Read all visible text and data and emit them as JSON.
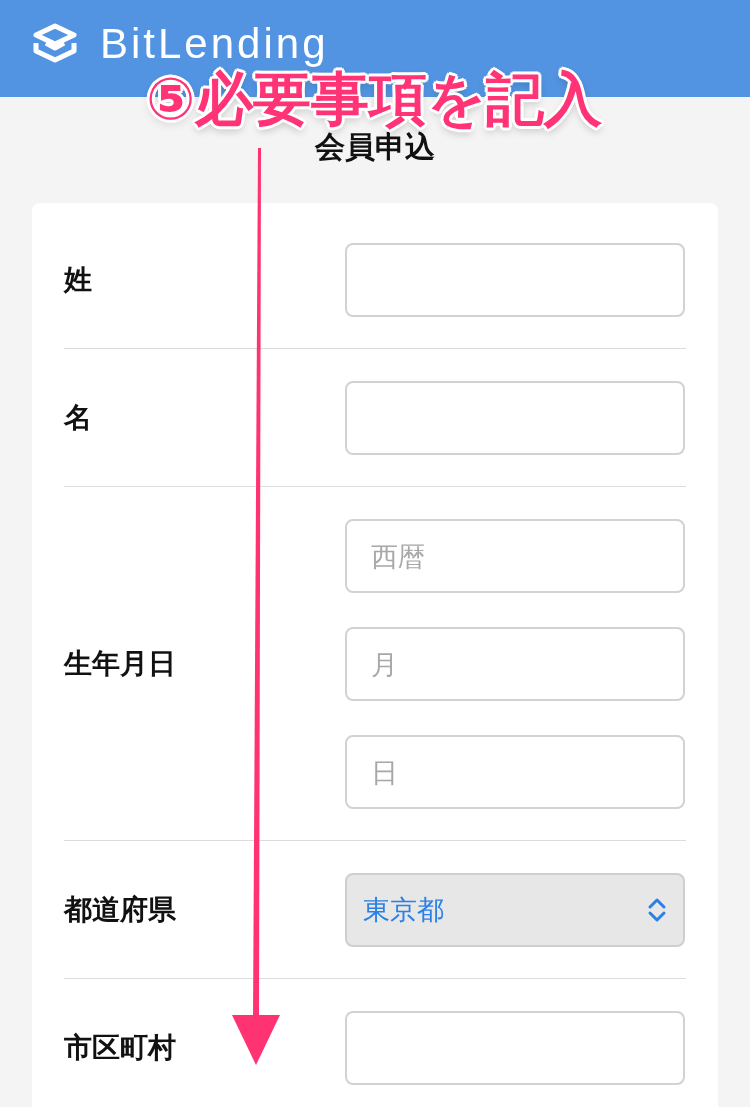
{
  "header": {
    "brand": "BitLending"
  },
  "annotation": {
    "text": "⑤必要事項を記入"
  },
  "title": "会員申込",
  "form": {
    "rows": [
      {
        "label": "姓",
        "kind": "text"
      },
      {
        "label": "名",
        "kind": "text"
      },
      {
        "label": "生年月日",
        "kind": "date",
        "placeholders": [
          "西暦",
          "月",
          "日"
        ]
      },
      {
        "label": "都道府県",
        "kind": "select",
        "value": "東京都"
      },
      {
        "label": "市区町村",
        "kind": "text"
      }
    ]
  }
}
